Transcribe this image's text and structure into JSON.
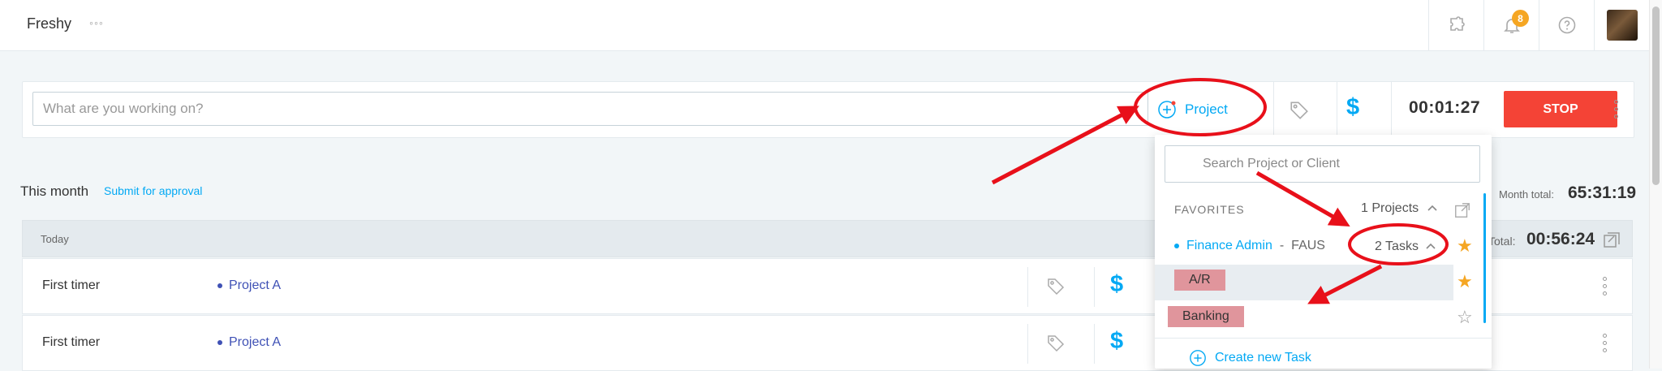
{
  "header": {
    "brand": "Freshy",
    "more_label": "◦◦◦",
    "notification_count": "8"
  },
  "timer_bar": {
    "placeholder": "What are you working on?",
    "project_label": "Project",
    "billable_symbol": "$",
    "elapsed": "00:01:27",
    "stop_label": "STOP"
  },
  "summary": {
    "period": "This month",
    "submit_label": "Submit for approval",
    "month_total_label": "Month total:",
    "month_total": "65:31:19"
  },
  "day": {
    "label": "Today",
    "total_label": "Total:",
    "total": "00:56:24"
  },
  "entries": [
    {
      "description": "First timer",
      "project": "Project A",
      "billable_symbol": "$"
    },
    {
      "description": "First timer",
      "project": "Project A",
      "billable_symbol": "$"
    }
  ],
  "dropdown": {
    "search_placeholder": "Search Project or Client",
    "favorites_label": "FAVORITES",
    "projects_count": "1 Projects",
    "project_name": "Finance Admin",
    "separator": "-",
    "client": "FAUS",
    "tasks_count": "2 Tasks",
    "tasks": [
      "A/R",
      "Banking"
    ],
    "create_task_label": "Create new Task"
  },
  "colors": {
    "accent": "#03a9f4",
    "stop": "#f44336",
    "star": "#f5a623",
    "annotation": "#e8101a"
  }
}
